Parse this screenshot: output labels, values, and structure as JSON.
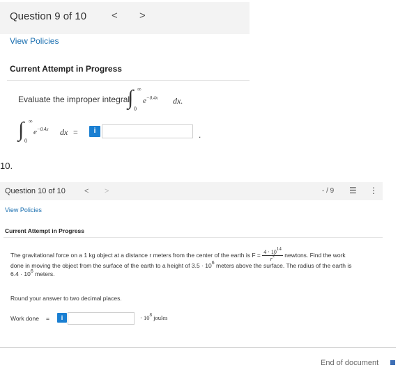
{
  "q9": {
    "title": "Question 9 of 10",
    "prev": "<",
    "next": ">",
    "view_policies": "View Policies",
    "attempt": "Current Attempt in Progress",
    "prompt": "Evaluate the improper integral",
    "integral_sign": "∫",
    "upper_limit": "∞",
    "lower_limit": "0",
    "integrand_base": "e",
    "integrand_exp": "−0.4x",
    "dx": "dx.",
    "answer_dx": "dx",
    "equals": "=",
    "info": "i",
    "period": ".",
    "answer_value": ""
  },
  "num10": "10.",
  "q10": {
    "title": "Question 10 of 10",
    "prev": "<",
    "next": ">",
    "page": "- / 9",
    "list_icon": "☰",
    "more_icon": "⋮",
    "view_policies": "View Policies",
    "attempt": "Current Attempt in Progress",
    "line1_a": "The gravitational force on a 1 kg object at a distance r meters from the center of the earth is F =",
    "frac_num": "4 · 10",
    "frac_num_exp": "14",
    "frac_den": "r",
    "frac_den_exp": "2",
    "line1_b": "newtons. Find the work",
    "line2": "done in moving the object from the surface of the earth to a height of 3.5 · 10",
    "line2_exp": "6",
    "line2_b": " meters above the surface. The radius of the earth is",
    "line3": "6.4 · 10",
    "line3_exp": "6",
    "line3_b": " meters.",
    "round": "Round your answer to two decimal places.",
    "work_label": "Work done",
    "equals": "=",
    "info": "i",
    "unit_a": "· 10",
    "unit_exp": "8",
    "unit_b": " joules",
    "answer_value": ""
  },
  "footer": {
    "end_text": "End of document"
  },
  "colors": {
    "accent": "#1a7fd2",
    "link": "#1a6fb0",
    "header_bg": "#f3f3f3",
    "end_marker": "#3e6fb5"
  }
}
